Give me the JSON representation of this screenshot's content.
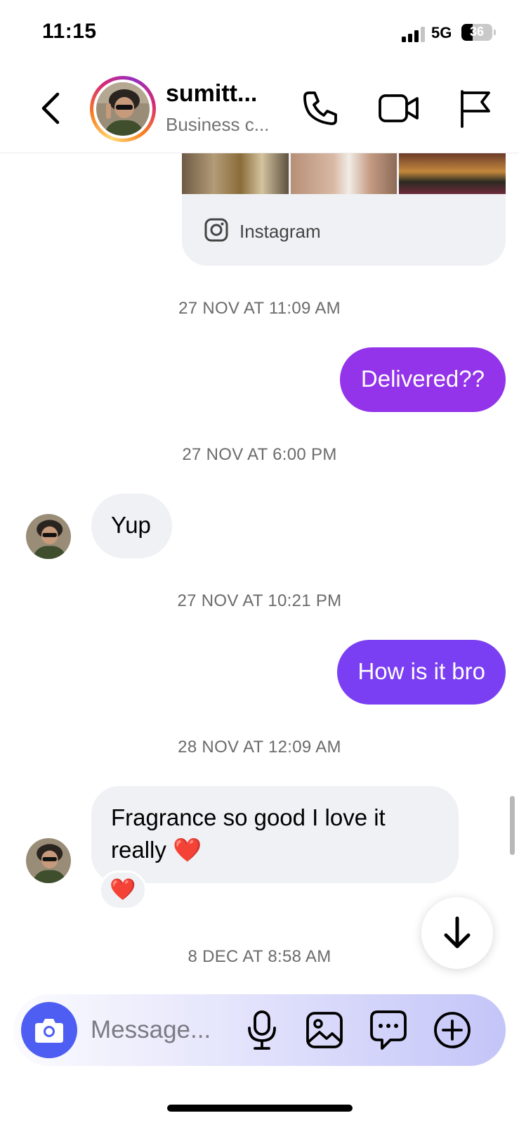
{
  "status_bar": {
    "time": "11:15",
    "network": "5G",
    "battery": "36",
    "battery_level": 0.36
  },
  "header": {
    "contact_name": "sumitt...",
    "contact_subtitle": "Business c..."
  },
  "shared_card": {
    "source": "Instagram"
  },
  "messages": [
    {
      "timestamp": "27 NOV AT 11:09 AM",
      "direction": "outgoing",
      "text": "Delivered??",
      "bubble_color": "#9333ea"
    },
    {
      "timestamp": "27 NOV AT 6:00 PM",
      "direction": "incoming",
      "text": "Yup"
    },
    {
      "timestamp": "27 NOV AT 10:21 PM",
      "direction": "outgoing",
      "text": "How is it bro",
      "bubble_color": "#7a3ff2"
    },
    {
      "timestamp": "28 NOV AT 12:09 AM",
      "direction": "incoming",
      "text": "Fragrance so good I love it really ❤️",
      "reaction": "❤️"
    }
  ],
  "last_timestamp": "8 DEC AT 8:58 AM",
  "composer": {
    "placeholder": "Message..."
  },
  "colors": {
    "camera_button": "#4e5ef2",
    "timestamp": "#6b6b6b",
    "incoming_bubble": "#eff1f4"
  },
  "icons": [
    "back-icon",
    "call-icon",
    "video-call-icon",
    "flag-icon",
    "instagram-icon",
    "arrow-down-icon",
    "camera-icon",
    "mic-icon",
    "gallery-icon",
    "sticker-icon",
    "add-icon"
  ]
}
